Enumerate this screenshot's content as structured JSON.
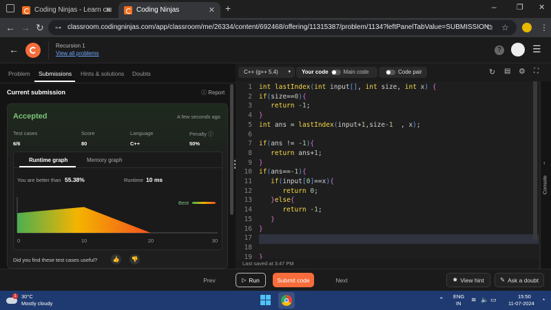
{
  "browser": {
    "tabs": [
      {
        "title": "Coding Ninjas - Learn coding o"
      },
      {
        "title": "Coding Ninjas"
      }
    ],
    "new_tab": "+",
    "url": "classroom.codingninjas.com/app/classroom/me/26334/content/692468/offering/11315387/problem/1134?leftPanelTabValue=SUBMISSION"
  },
  "header": {
    "breadcrumb": "Recursion 1",
    "view_all": "View all problems"
  },
  "left_panel": {
    "tabs": [
      "Problem",
      "Submissions",
      "Hints & solutions",
      "Doubts"
    ],
    "active_tab": "Submissions",
    "section_title": "Current submission",
    "report_label": "Report",
    "status": "Accepted",
    "time_ago": "A few seconds ago",
    "stats": [
      {
        "label": "Test cases",
        "value": "6/6"
      },
      {
        "label": "Score",
        "value": "80"
      },
      {
        "label": "Language",
        "value": "C++"
      },
      {
        "label": "Penalty",
        "value": "50%"
      }
    ],
    "graph_tabs": [
      "Runtime graph",
      "Memory graph"
    ],
    "better_than_label": "You are better than",
    "better_than_value": "55.38%",
    "runtime_label": "Runtime",
    "runtime_value": "10 ms",
    "best_label": "Best",
    "x_ticks": [
      "0",
      "10",
      "20",
      "30"
    ],
    "feedback_question": "Did you find these test cases useful?"
  },
  "chart_data": {
    "type": "area",
    "x": [
      0,
      10,
      20
    ],
    "values": [
      0.55,
      0.72,
      0
    ],
    "xlim": [
      0,
      30
    ],
    "x_ticks": [
      0,
      10,
      20,
      30
    ],
    "legend": [
      "Best"
    ]
  },
  "editor": {
    "language": "C++ (g++ 5.4)",
    "your_code": "Your code",
    "main_code": "Main code",
    "code_pair": "Code pair",
    "lines": [
      "int lastIndex(int input[], int size, int x) {",
      "if(size==0){",
      "   return -1;",
      "}",
      "int ans = lastIndex(input+1,size-1  , x);",
      "",
      "if(ans != -1){",
      "   return ans+1;",
      "}",
      "if(ans==-1){",
      "   if(input[0]==x){",
      "      return 0;",
      "   }else{",
      "      return -1;",
      "   }",
      "}",
      "",
      "",
      "}"
    ],
    "line_numbers": [
      "1",
      "2",
      "3",
      "4",
      "5",
      "6",
      "7",
      "8",
      "9",
      "10",
      "11",
      "12",
      "13",
      "14",
      "15",
      "16",
      "17",
      "18",
      "19"
    ],
    "last_saved": "Last saved at 3:47 PM",
    "console_label": "Console"
  },
  "footer": {
    "prev": "Prev",
    "run": "Run",
    "submit": "Submit code",
    "next": "Next",
    "view_hint": "View hint",
    "ask_doubt": "Ask a doubt"
  },
  "taskbar": {
    "temp": "30°C",
    "weather": "Mostly cloudy",
    "lang1": "ENG",
    "lang2": "IN",
    "time": "15:50",
    "date": "11-07-2024"
  },
  "colors": {
    "accent": "#f66c3b",
    "accepted": "#7cc47a"
  }
}
